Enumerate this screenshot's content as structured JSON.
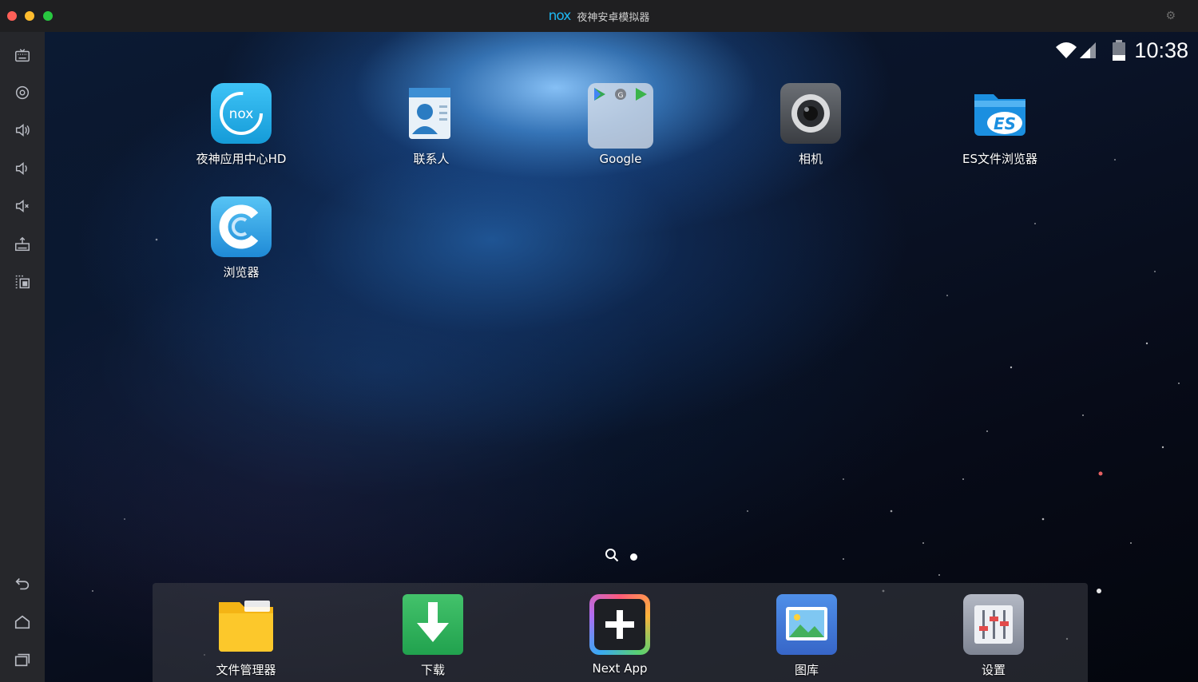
{
  "window": {
    "logo_text": "nox",
    "title": "夜神安卓模拟器"
  },
  "sidebar": {
    "items": [
      {
        "name": "keyboard-icon"
      },
      {
        "name": "location-icon"
      },
      {
        "name": "volume-up-icon"
      },
      {
        "name": "volume-down-icon"
      },
      {
        "name": "mute-icon"
      },
      {
        "name": "apk-install-icon"
      },
      {
        "name": "multi-instance-icon"
      },
      {
        "name": "back-icon"
      },
      {
        "name": "home-icon"
      },
      {
        "name": "recent-apps-icon"
      }
    ]
  },
  "status": {
    "time": "10:38"
  },
  "home_apps": [
    {
      "label": "夜神应用中心HD",
      "icon": "nox-app-center-icon"
    },
    {
      "label": "联系人",
      "icon": "contacts-icon"
    },
    {
      "label": "Google",
      "icon": "google-folder-icon"
    },
    {
      "label": "相机",
      "icon": "camera-icon"
    },
    {
      "label": "ES文件浏览器",
      "icon": "es-file-explorer-icon"
    },
    {
      "label": "浏览器",
      "icon": "browser-icon"
    }
  ],
  "dock_apps": [
    {
      "label": "文件管理器",
      "icon": "file-manager-icon"
    },
    {
      "label": "下载",
      "icon": "download-icon"
    },
    {
      "label": "Next App",
      "icon": "next-app-icon"
    },
    {
      "label": "图库",
      "icon": "gallery-icon"
    },
    {
      "label": "设置",
      "icon": "settings-icon"
    }
  ],
  "colors": {
    "accent": "#1eb7f0",
    "close": "#fe5f57",
    "minimize": "#febc2e",
    "maximize": "#28c840"
  }
}
